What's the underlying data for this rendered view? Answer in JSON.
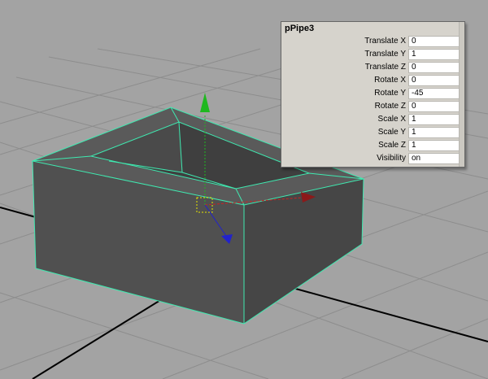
{
  "object_name": "pPipe3",
  "channels": [
    {
      "label": "Translate X",
      "value": "0"
    },
    {
      "label": "Translate Y",
      "value": "1"
    },
    {
      "label": "Translate Z",
      "value": "0"
    },
    {
      "label": "Rotate X",
      "value": "0"
    },
    {
      "label": "Rotate Y",
      "value": "-45"
    },
    {
      "label": "Rotate Z",
      "value": "0"
    },
    {
      "label": "Scale X",
      "value": "1"
    },
    {
      "label": "Scale Y",
      "value": "1"
    },
    {
      "label": "Scale Z",
      "value": "1"
    },
    {
      "label": "Visibility",
      "value": "on"
    }
  ],
  "colors": {
    "viewport_bg": "#a3a3a3",
    "grid": "#8d8d8d",
    "axis": "#000000",
    "selection_wire": "#3fe9b0",
    "mesh_front": "#505050",
    "mesh_inner": "#3f3f3f",
    "mesh_rim": "#5a5a5a",
    "manip_x": "#cc2222",
    "manip_y": "#1fb81f",
    "manip_z": "#2222cc",
    "pivot": "#e6e600"
  },
  "icons": {
    "move_handle_x": "red-arrow-icon",
    "move_handle_y": "green-arrow-icon",
    "move_handle_z": "blue-arrow-icon"
  }
}
